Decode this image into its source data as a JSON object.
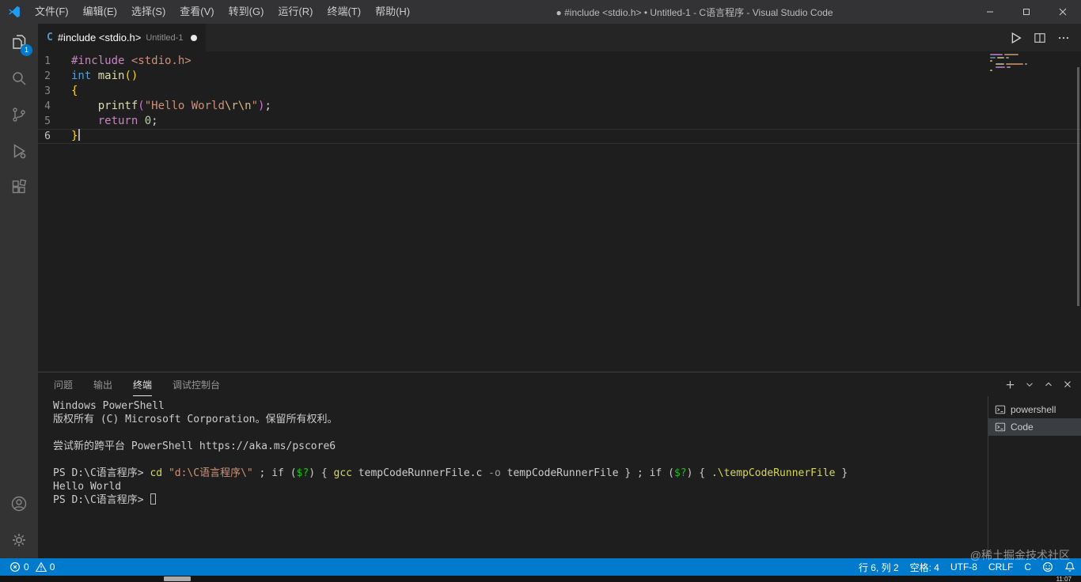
{
  "title_bar": {
    "menus": [
      "文件(F)",
      "编辑(E)",
      "选择(S)",
      "查看(V)",
      "转到(G)",
      "运行(R)",
      "终端(T)",
      "帮助(H)"
    ],
    "title": "● #include <stdio.h> • Untitled-1 - C语言程序 - Visual Studio Code"
  },
  "activity_bar": {
    "explorer_badge": "1"
  },
  "tab_bar": {
    "file_icon": "C",
    "tab_label": "#include <stdio.h>",
    "tab_description": "Untitled-1"
  },
  "editor": {
    "lines": [
      {
        "num": "1",
        "tokens": [
          {
            "t": "#include ",
            "c": "kw"
          },
          {
            "t": "<stdio.h>",
            "c": "str"
          }
        ]
      },
      {
        "num": "2",
        "tokens": [
          {
            "t": "int",
            "c": "type"
          },
          {
            "t": " ",
            "c": "pl"
          },
          {
            "t": "main",
            "c": "fn"
          },
          {
            "t": "()",
            "c": "b1"
          }
        ]
      },
      {
        "num": "3",
        "tokens": [
          {
            "t": "{",
            "c": "b1"
          }
        ]
      },
      {
        "num": "4",
        "tokens": [
          {
            "t": "    ",
            "c": "pl"
          },
          {
            "t": "printf",
            "c": "fn"
          },
          {
            "t": "(",
            "c": "b2"
          },
          {
            "t": "\"Hello World",
            "c": "str"
          },
          {
            "t": "\\r\\n",
            "c": "esc"
          },
          {
            "t": "\"",
            "c": "str"
          },
          {
            "t": ")",
            "c": "b2"
          },
          {
            "t": ";",
            "c": "pl"
          }
        ]
      },
      {
        "num": "5",
        "tokens": [
          {
            "t": "    ",
            "c": "pl"
          },
          {
            "t": "return",
            "c": "kw"
          },
          {
            "t": " ",
            "c": "pl"
          },
          {
            "t": "0",
            "c": "num"
          },
          {
            "t": ";",
            "c": "pl"
          }
        ]
      },
      {
        "num": "6",
        "tokens": [
          {
            "t": "}",
            "c": "b1"
          }
        ],
        "current": true,
        "cursor": true
      }
    ]
  },
  "panel": {
    "tabs": [
      {
        "label": "问题"
      },
      {
        "label": "输出"
      },
      {
        "label": "终端"
      },
      {
        "label": "调试控制台"
      }
    ],
    "terminal_list": [
      {
        "label": "powershell"
      },
      {
        "label": "Code"
      }
    ],
    "terminal": {
      "lines": [
        {
          "tokens": [
            {
              "t": "Windows PowerShell",
              "c": "tw"
            }
          ]
        },
        {
          "tokens": [
            {
              "t": "版权所有 (C) Microsoft Corporation。保留所有权利。",
              "c": "tw"
            }
          ]
        },
        {
          "tokens": []
        },
        {
          "tokens": [
            {
              "t": "尝试新的跨平台 PowerShell https://aka.ms/pscore6",
              "c": "tw"
            }
          ]
        },
        {
          "tokens": []
        },
        {
          "tokens": [
            {
              "t": "PS D:\\C语言程序> ",
              "c": "tw"
            },
            {
              "t": "cd",
              "c": "ty"
            },
            {
              "t": " ",
              "c": "tw"
            },
            {
              "t": "\"d:\\C语言程序\\\"",
              "c": "ts"
            },
            {
              "t": " ; ",
              "c": "tw"
            },
            {
              "t": "if",
              "c": "tw"
            },
            {
              "t": " (",
              "c": "tw"
            },
            {
              "t": "$?",
              "c": "tg"
            },
            {
              "t": ") { ",
              "c": "tw"
            },
            {
              "t": "gcc",
              "c": "ty"
            },
            {
              "t": " tempCodeRunnerFile.c ",
              "c": "tw"
            },
            {
              "t": "-o",
              "c": "td"
            },
            {
              "t": " tempCodeRunnerFile } ; ",
              "c": "tw"
            },
            {
              "t": "if",
              "c": "tw"
            },
            {
              "t": " (",
              "c": "tw"
            },
            {
              "t": "$?",
              "c": "tg"
            },
            {
              "t": ") { ",
              "c": "tw"
            },
            {
              "t": ".\\tempCodeRunnerFile",
              "c": "ty"
            },
            {
              "t": " }",
              "c": "tw"
            }
          ]
        },
        {
          "tokens": [
            {
              "t": "Hello World",
              "c": "tw"
            }
          ]
        },
        {
          "tokens": [
            {
              "t": "PS D:\\C语言程序> ",
              "c": "tw"
            }
          ],
          "cursor": true
        }
      ]
    }
  },
  "status_bar": {
    "errors": "0",
    "warnings": "0",
    "line_col": "行 6, 列 2",
    "spaces": "空格: 4",
    "encoding": "UTF-8",
    "eol": "CRLF",
    "language": "C"
  },
  "watermark": "@稀土掘金技术社区",
  "taskbar": {
    "clock": "11:07"
  },
  "colors": {
    "accent": "#007ACC",
    "editor_bg": "#1E1E1E",
    "status_bg": "#007ACC"
  }
}
